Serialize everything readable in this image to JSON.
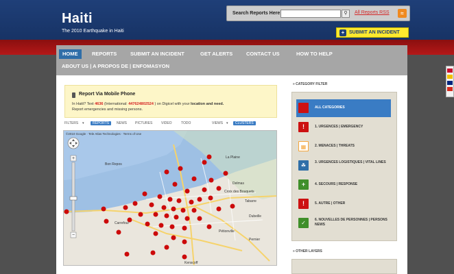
{
  "header": {
    "title": "Haiti",
    "subtitle": "The 2010 Earthquake in Haiti",
    "search_label": "Search Reports Here:",
    "search_value": "",
    "search_button_icon": "magnifier-icon",
    "rss_label": "All Reports RSS",
    "submit_label": "SUBMIT AN INCIDENT"
  },
  "nav": {
    "items": [
      "HOME",
      "REPORTS",
      "SUBMIT AN INCIDENT",
      "GET ALERTS",
      "CONTACT US",
      "HOW TO HELP"
    ],
    "second_row": "ABOUT US | A PROPOS DE | ENFOMASYON",
    "active": "HOME"
  },
  "mobile": {
    "title": "Report Via Mobile Phone",
    "line1_a": "In Haiti? Text",
    "code": "4636",
    "line1_b": "(International:",
    "intl": "447624802524",
    "line1_c": ") on Digicel with your",
    "bold1": "location and need.",
    "line2": "Report emergencies and missing persons."
  },
  "filters": {
    "label": "FILTERS",
    "options": [
      "REPORTS",
      "NEWS",
      "PICTURES",
      "VIDEO",
      "TODO"
    ],
    "active": "REPORTS",
    "views_label": "VIEWS",
    "views_active": "CLUSTERS"
  },
  "map": {
    "attribution": "©2010 Google · Tele Atlas Technologies · Terms of Use",
    "place_labels": [
      "Bon Repos",
      "Croix des Bouquets",
      "Delmas",
      "Carrefour",
      "Pétionville",
      "Tabarre",
      "Kenscoff",
      "La Plaine",
      "Dubeille",
      "Pernier"
    ]
  },
  "categories": {
    "heading": "CATEGORY FILTER",
    "items": [
      {
        "label": "ALL CATEGORIES",
        "color": "#cc1111",
        "icon": "square-icon"
      },
      {
        "label": "1. URGENCES | EMERGENCY",
        "color": "#cc1111",
        "icon": "exclamation-icon"
      },
      {
        "label": "2. MENACES | THREATS",
        "color": "#f5a53a",
        "icon": "grid-icon"
      },
      {
        "label": "3. URGENCES LOGISTIQUES | VITAL LINES",
        "color": "#2f6ea8",
        "icon": "water-drops-icon"
      },
      {
        "label": "4. SECOURS | RESPONSE",
        "color": "#3f8f2a",
        "icon": "plus-icon"
      },
      {
        "label": "5. AUTRE | OTHER",
        "color": "#cc1111",
        "icon": "exclamation-icon"
      },
      {
        "label": "6. NOUVELLES DE PERSONNES | PERSONS NEWS",
        "color": "#3f8f2a",
        "icon": "check-icon"
      }
    ],
    "other_layers_heading": "OTHER LAYERS"
  }
}
